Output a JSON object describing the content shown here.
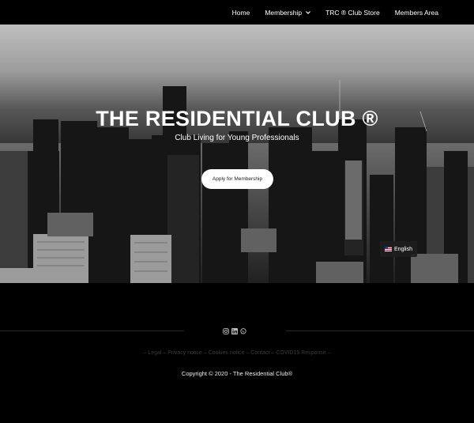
{
  "nav": {
    "items": [
      {
        "label": "Home"
      },
      {
        "label": "Membership"
      },
      {
        "label": "TRC ® Club Store"
      },
      {
        "label": "Members Area"
      }
    ]
  },
  "hero": {
    "title": "THE RESIDENTIAL CLUB ®",
    "subtitle": "Club Living for Young Professionals",
    "cta_label": "Apply for Membership",
    "language_label": "English"
  },
  "footer": {
    "social_icons": [
      "instagram-icon",
      "linkedin-icon",
      "whatsapp-icon"
    ],
    "links": [
      {
        "label": "Legal"
      },
      {
        "label": "Privacy notice"
      },
      {
        "label": "Cookies notice"
      },
      {
        "label": "Contact"
      },
      {
        "label": "COVID19 Response"
      }
    ],
    "copyright": "Copyright © 2020 - The Residential Club®"
  }
}
